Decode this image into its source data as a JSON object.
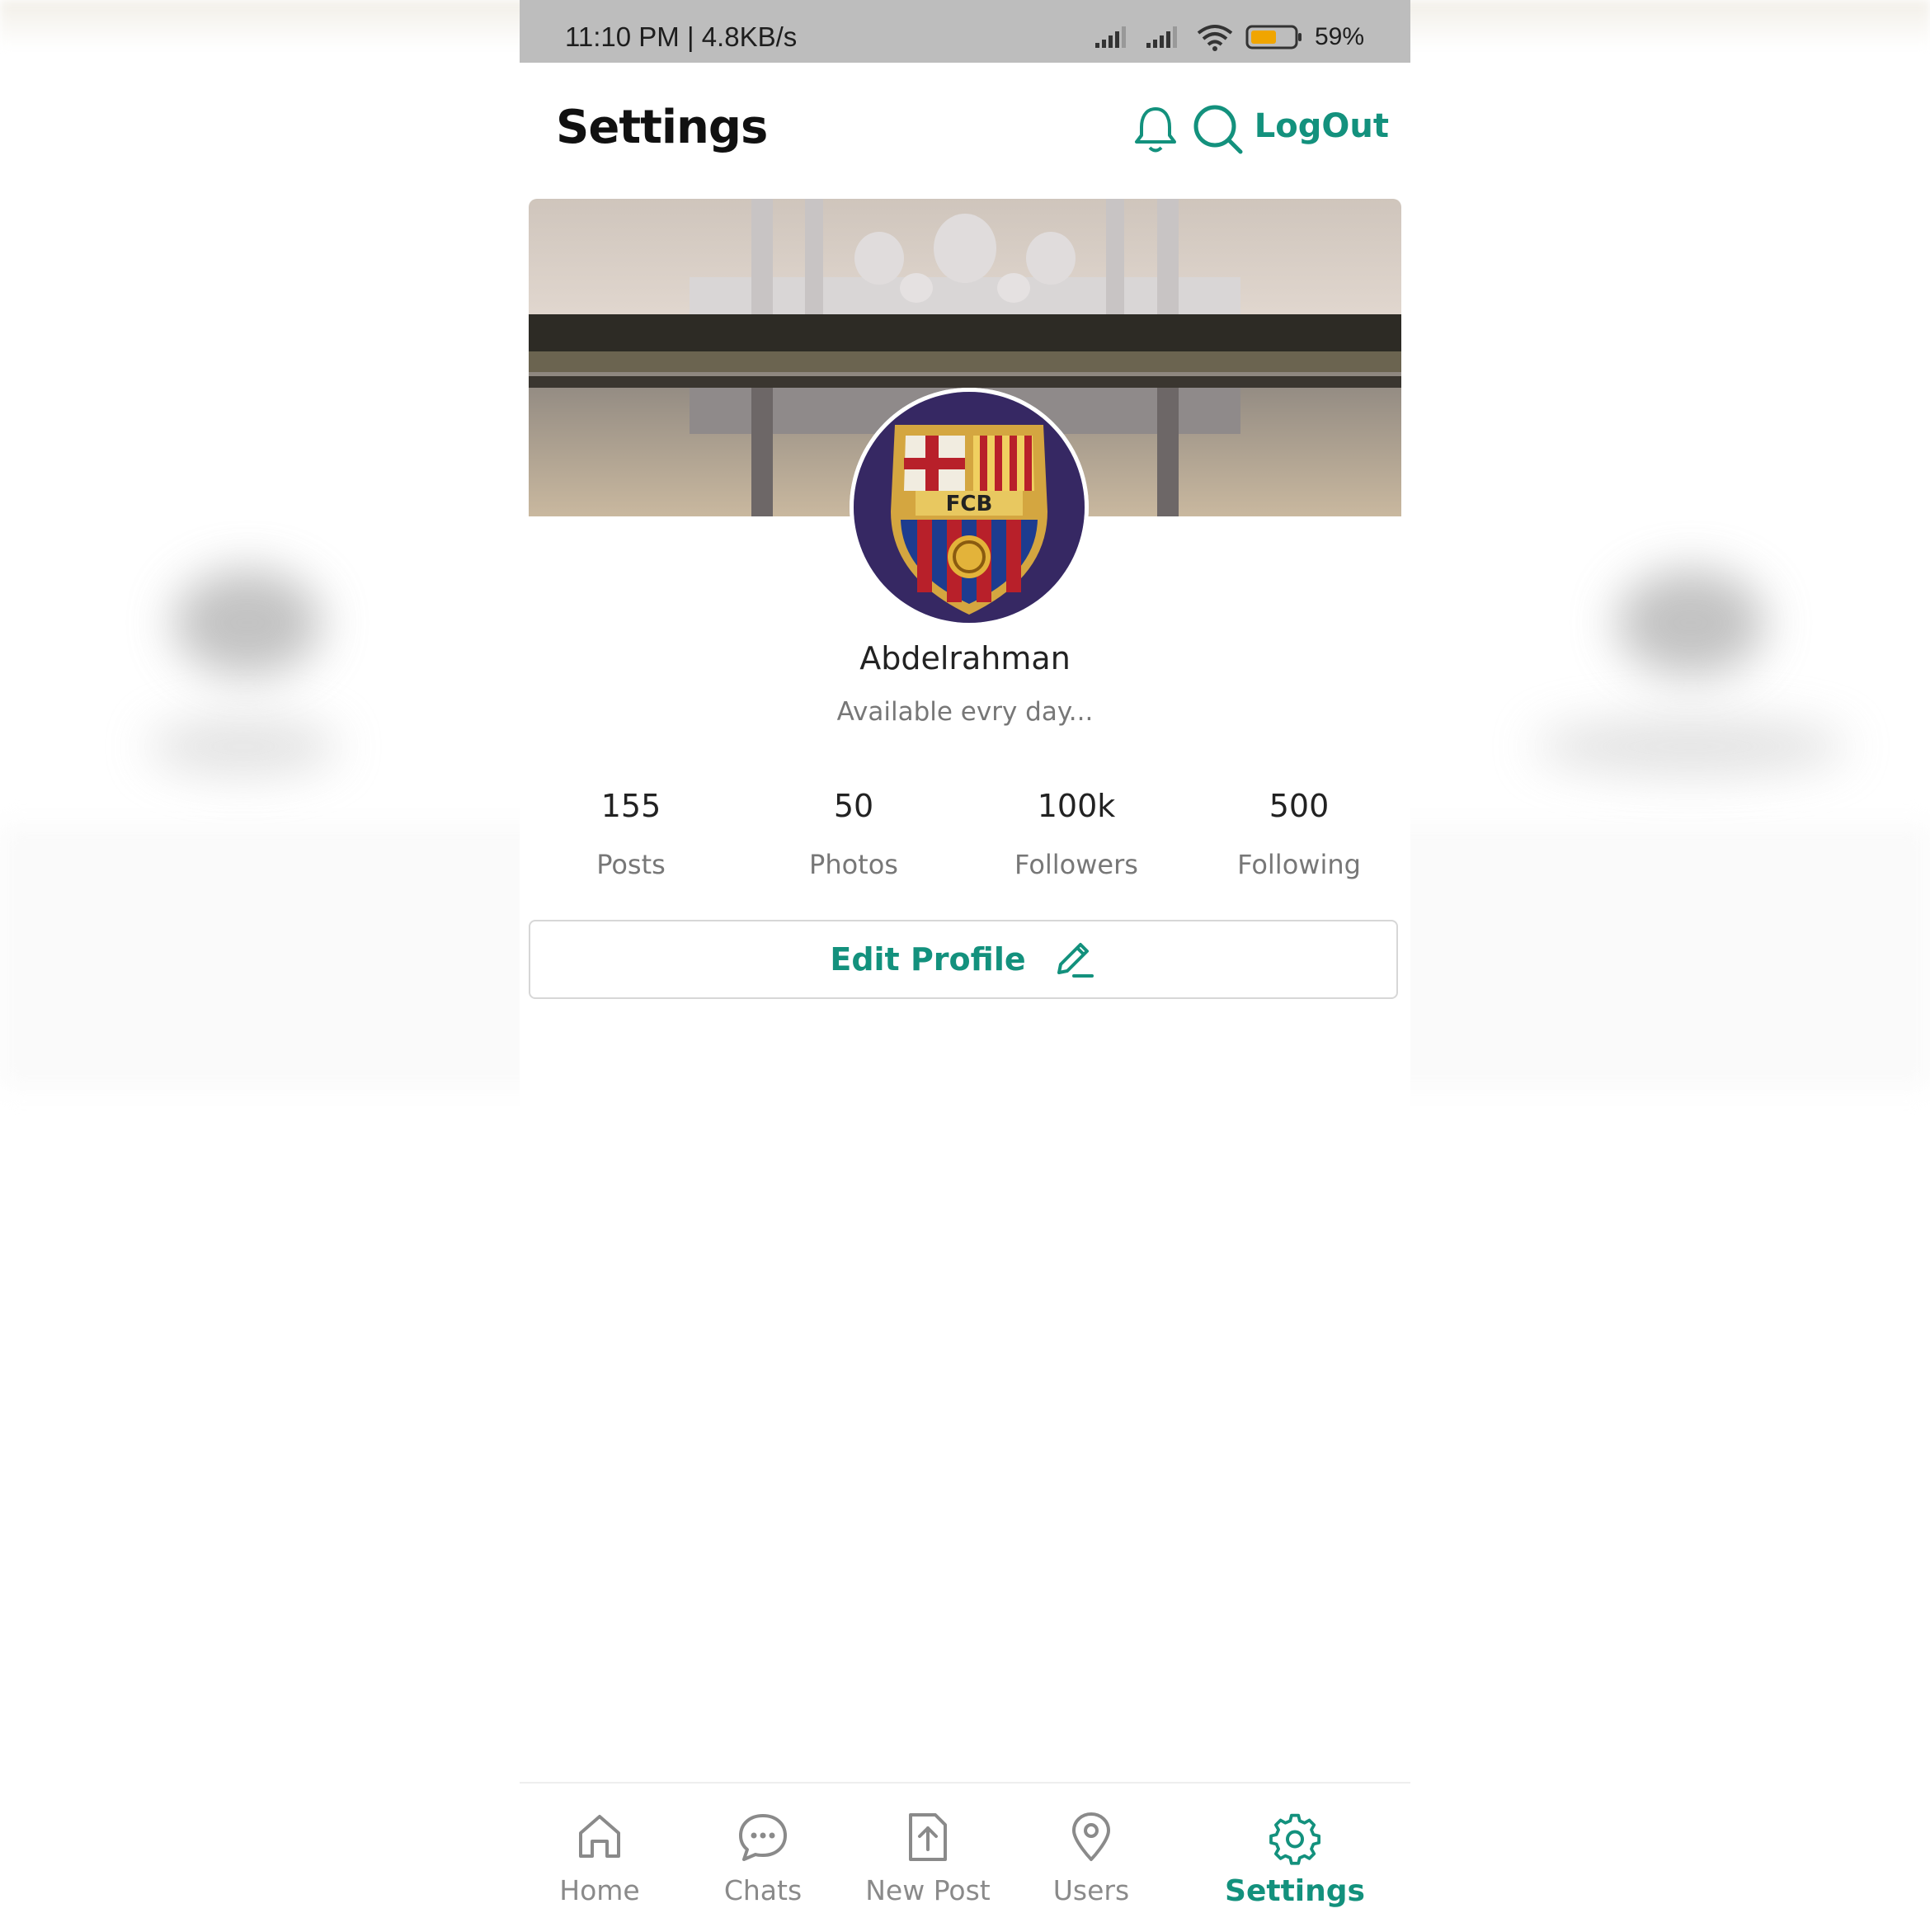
{
  "status_bar": {
    "time_speed": "11:10 PM | 4.8KB/s",
    "battery": "59%"
  },
  "header": {
    "title": "Settings",
    "logout_label": "LogOut"
  },
  "profile": {
    "avatar_text": "FCB",
    "name": "Abdelrahman",
    "bio": "Available evry day..."
  },
  "stats": [
    {
      "value": "155",
      "label": "Posts"
    },
    {
      "value": "50",
      "label": "Photos"
    },
    {
      "value": "100k",
      "label": "Followers"
    },
    {
      "value": "500",
      "label": "Following"
    }
  ],
  "edit_button": {
    "label": "Edit Profile"
  },
  "nav": [
    {
      "label": "Home",
      "icon": "home-icon"
    },
    {
      "label": "Chats",
      "icon": "chat-icon"
    },
    {
      "label": "New Post",
      "icon": "upload-icon"
    },
    {
      "label": "Users",
      "icon": "location-icon"
    },
    {
      "label": "Settings",
      "icon": "gear-icon",
      "active": true
    }
  ],
  "colors": {
    "accent": "#13917d",
    "status_bar": "#bdbdbd",
    "muted_text": "#777777"
  }
}
